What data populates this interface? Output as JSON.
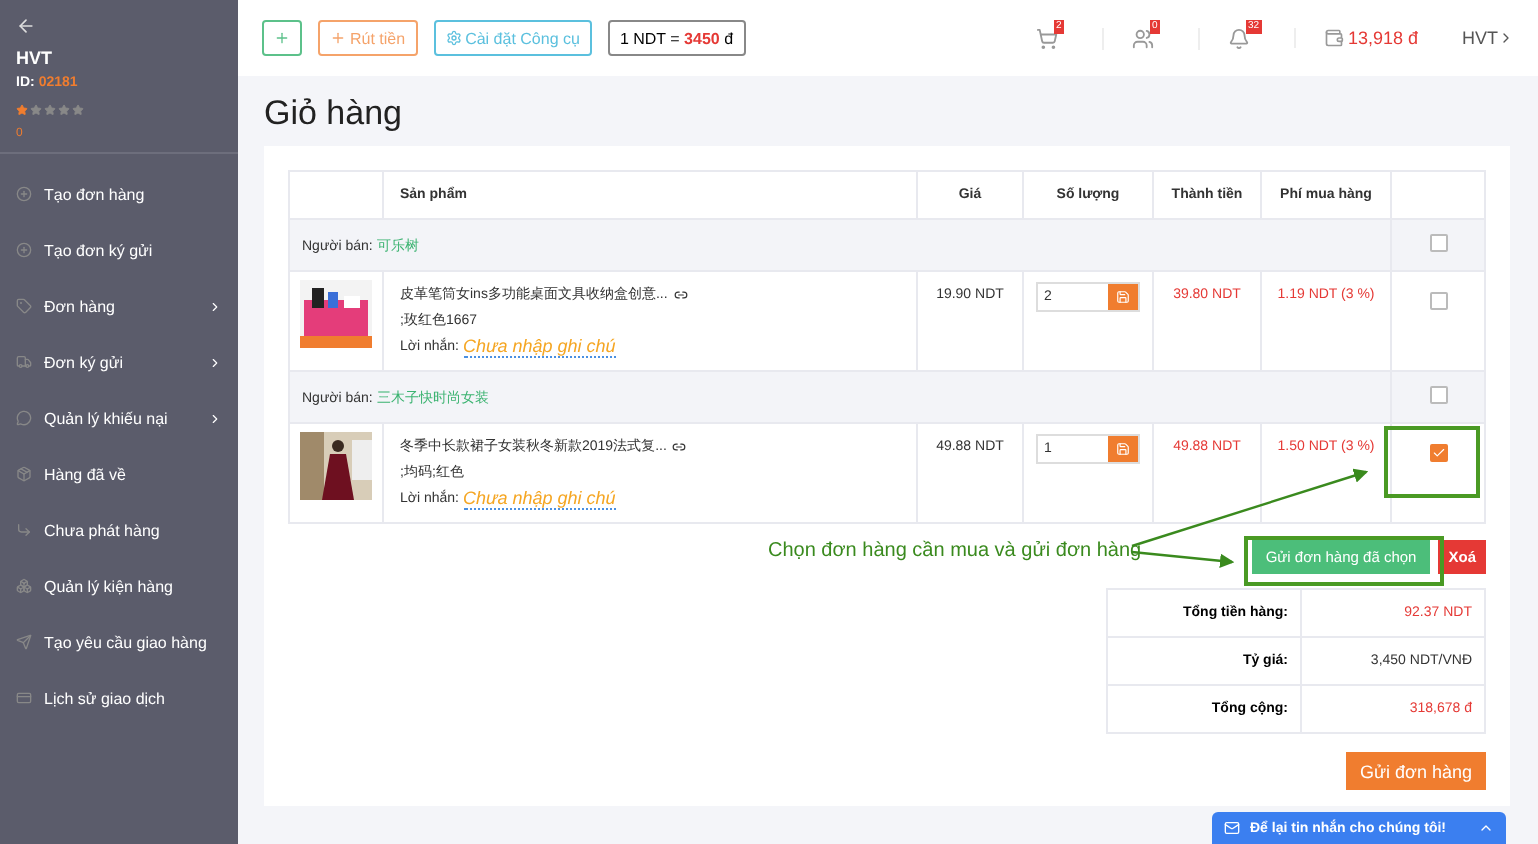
{
  "sidebar": {
    "user": "HVT",
    "id_label": "ID:",
    "id": "02181",
    "stars": 1,
    "points": "0",
    "items": [
      {
        "label": "Tạo đơn hàng",
        "expandable": false
      },
      {
        "label": "Tạo đơn ký gửi",
        "expandable": false
      },
      {
        "label": "Đơn hàng",
        "expandable": true
      },
      {
        "label": "Đơn ký gửi",
        "expandable": true
      },
      {
        "label": "Quản lý khiếu nại",
        "expandable": true
      },
      {
        "label": "Hàng đã về",
        "expandable": false
      },
      {
        "label": "Chưa phát hàng",
        "expandable": false
      },
      {
        "label": "Quản lý kiện hàng",
        "expandable": false
      },
      {
        "label": "Tạo yêu cầu giao hàng",
        "expandable": false
      },
      {
        "label": "Lịch sử giao dịch",
        "expandable": false
      }
    ]
  },
  "topbar": {
    "buttons": [
      {
        "kind": "plus"
      },
      {
        "kind": "withdraw",
        "label": "Rút tiền"
      },
      {
        "kind": "tools",
        "label": "Cài đặt Công cụ"
      }
    ],
    "rate": {
      "prefix": "1 NDT = ",
      "value": "3450",
      "suffix": " đ"
    },
    "badges": [
      {
        "count": "2"
      },
      {
        "count": "0"
      },
      {
        "count": "32"
      }
    ],
    "wallet": "13,918 đ",
    "user": "HVT"
  },
  "title": "Giỏ hàng",
  "table": {
    "columns": [
      "Sản phẩm",
      "Giá",
      "Số lượng",
      "Thành tiền",
      "Phí mua hàng"
    ],
    "groups": [
      {
        "seller_label": "Người bán:",
        "seller": "可乐树",
        "checked": false,
        "items": [
          {
            "name": "皮革笔筒女ins多功能桌面文具收纳盒创意...",
            "variant": ";玫红色1667",
            "note_label": "Lời nhắn:",
            "note": "Chưa nhập ghi chú",
            "price": "19.90 NDT",
            "quantity": "2",
            "total": "39.80 NDT",
            "fee": "1.19 NDT (3 %)",
            "checked": false
          }
        ]
      },
      {
        "seller_label": "Người bán:",
        "seller": "三木子快时尚女装",
        "checked": false,
        "items": [
          {
            "name": "冬季中长款裙子女装秋冬新款2019法式复...",
            "variant": ";均码;红色",
            "note_label": "Lời nhắn:",
            "note": "Chưa nhập ghi chú",
            "price": "49.88 NDT",
            "quantity": "1",
            "total": "49.88 NDT",
            "fee": "1.50 NDT (3 %)",
            "checked": true
          }
        ]
      }
    ]
  },
  "annotation": "Chọn đơn hàng cần mua và gửi đơn hàng",
  "actions": {
    "send_selected": "Gửi đơn hàng đã chọn",
    "delete": "Xoá"
  },
  "summary": [
    {
      "label": "Tổng tiền hàng:",
      "value": "92.37 NDT",
      "highlight": true
    },
    {
      "label": "Tỷ giá:",
      "value": "3,450 NDT/VNĐ",
      "highlight": false
    },
    {
      "label": "Tổng cộng:",
      "value": "318,678 đ",
      "highlight": true
    }
  ],
  "submit": "Gửi đơn hàng",
  "chat": "Để lại tin nhắn cho chúng tôi!"
}
